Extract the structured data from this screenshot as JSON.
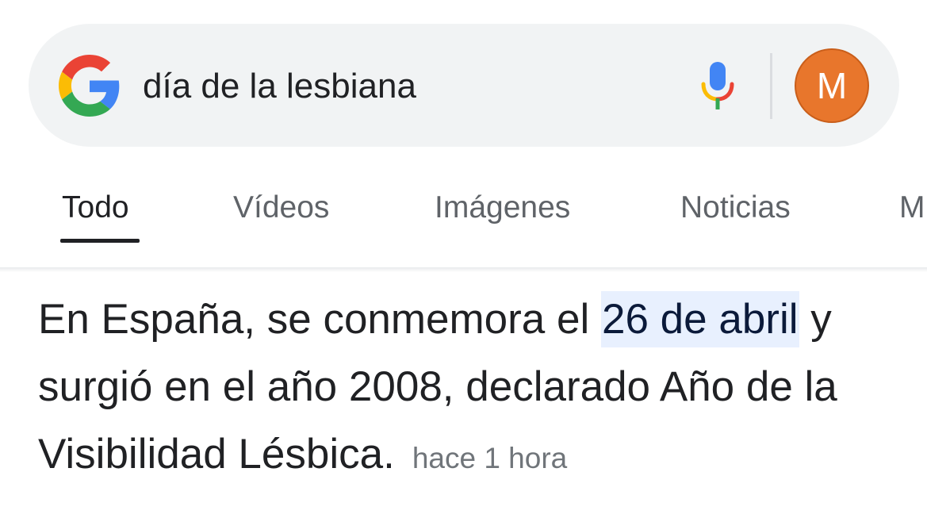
{
  "search": {
    "query": "día de la lesbiana",
    "logo_icon": "google-g-icon",
    "mic_icon": "microphone-icon",
    "avatar_letter": "M",
    "avatar_color": "#e8762c"
  },
  "tabs": [
    {
      "label": "Todo",
      "active": true
    },
    {
      "label": "Vídeos",
      "active": false
    },
    {
      "label": "Imágenes",
      "active": false
    },
    {
      "label": "Noticias",
      "active": false
    },
    {
      "label": "M",
      "active": false
    }
  ],
  "answer": {
    "text_before": "En España, se conmemora el ",
    "highlight": "26 de abril",
    "text_after": " y surgió en el año 2008, declarado Año de la Visibilidad Lésbica.",
    "timestamp": "hace 1 hora",
    "highlight_color": "#e8f0fe"
  }
}
